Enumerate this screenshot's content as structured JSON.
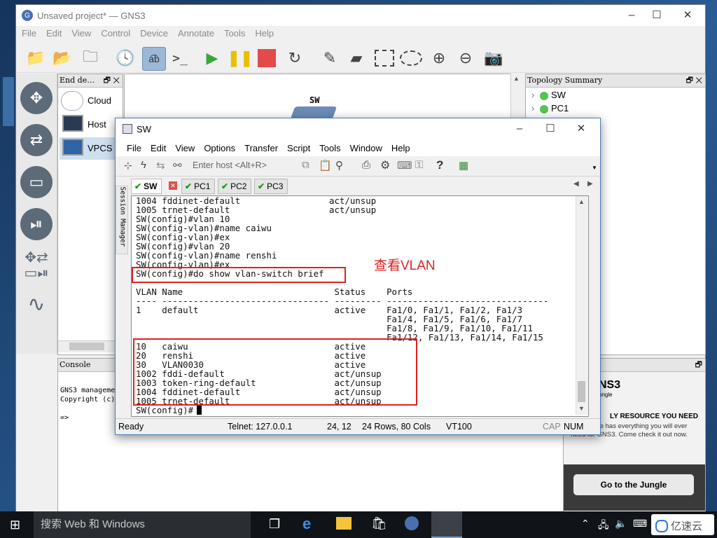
{
  "gns3": {
    "title": "Unsaved project* — GNS3",
    "menu": [
      "File",
      "Edit",
      "View",
      "Control",
      "Device",
      "Annotate",
      "Tools",
      "Help"
    ],
    "devices_panel": {
      "title": "End de…",
      "items": [
        "Cloud",
        "Host",
        "VPCS"
      ]
    },
    "canvas": {
      "device_label": "SW"
    },
    "topology": {
      "title": "Topology Summary",
      "items": [
        "SW",
        "PC1"
      ]
    },
    "console": {
      "title": "Console",
      "lines": [
        "GNS3 manageme",
        "Copyright (c)",
        "",
        "=>"
      ]
    },
    "newsfeed": {
      "title": "ewsfeed",
      "logo": "NS3",
      "logo_sub": "ungle",
      "heading": "LY RESOURCE YOU NEED",
      "body": "The Jungle has everything you will ever need for GNS3. Come check it out now.",
      "button": "Go to the Jungle"
    }
  },
  "crt": {
    "title": "SW",
    "menu": [
      "File",
      "Edit",
      "View",
      "Options",
      "Transfer",
      "Script",
      "Tools",
      "Window",
      "Help"
    ],
    "host_placeholder": "Enter host <Alt+R>",
    "session_manager": "Session Manager",
    "tabs": [
      {
        "label": "SW",
        "active": true
      },
      {
        "label": "PC1",
        "active": false
      },
      {
        "label": "PC2",
        "active": false
      },
      {
        "label": "PC3",
        "active": false
      }
    ],
    "terminal_lines": [
      "1004 fddinet-default                 act/unsup",
      "1005 trnet-default                   act/unsup",
      "SW(config)#vlan 10",
      "SW(config-vlan)#name caiwu",
      "SW(config-vlan)#ex",
      "SW(config)#vlan 20",
      "SW(config-vlan)#name renshi",
      "SW(config-vlan)#ex",
      "SW(config)#do show vlan-switch brief",
      "",
      "VLAN Name                             Status    Ports",
      "---- -------------------------------- --------- -------------------------------",
      "1    default                          active    Fa1/0, Fa1/1, Fa1/2, Fa1/3",
      "                                                Fa1/4, Fa1/5, Fa1/6, Fa1/7",
      "                                                Fa1/8, Fa1/9, Fa1/10, Fa1/11",
      "                                                Fa1/12, Fa1/13, Fa1/14, Fa1/15",
      "10   caiwu                            active",
      "20   renshi                           active",
      "30   VLAN0030                         active",
      "1002 fddi-default                     act/unsup",
      "1003 token-ring-default               act/unsup",
      "1004 fddinet-default                  act/unsup",
      "1005 trnet-default                    act/unsup",
      "SW(config)#"
    ],
    "annotation": "查看VLAN",
    "status": {
      "ready": "Ready",
      "conn": "Telnet: 127.0.0.1",
      "pos": "24,  12",
      "size": "24 Rows, 80 Cols",
      "term": "VT100",
      "cap": "CAP",
      "num": "NUM"
    }
  },
  "taskbar": {
    "search": "搜索 Web 和 Windows",
    "watermark": "亿速云"
  },
  "colors": {
    "annotation_red": "#e02020",
    "check_green": "#1a9a1a",
    "taskbar": "#101418"
  }
}
